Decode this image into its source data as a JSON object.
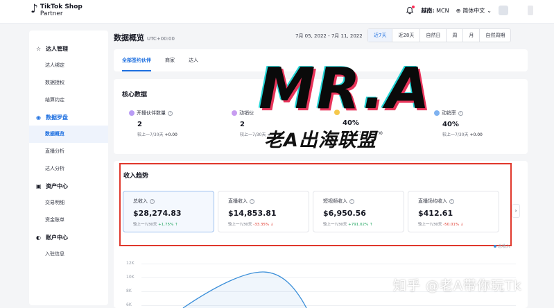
{
  "brand": {
    "name": "TikTok Shop",
    "sub": "Partner"
  },
  "topbar": {
    "region_label": "越南:",
    "region_value": "MCN",
    "language": "简体中文"
  },
  "sidebar": {
    "sections": [
      {
        "label": "达人管理",
        "items": [
          "达人绑定",
          "数据授权",
          "结算约定"
        ]
      },
      {
        "label": "数据罗盘",
        "items": [
          "数据概览",
          "直播分析",
          "达人分析"
        ]
      },
      {
        "label": "资产中心",
        "items": [
          "交易明细",
          "资金账单"
        ]
      },
      {
        "label": "账户中心",
        "items": [
          "入驻信息"
        ]
      }
    ]
  },
  "header": {
    "title": "数据概览",
    "timezone": "UTC+00:00",
    "date_range": "7月 05, 2022 - 7月 11, 2022",
    "periods": [
      "近7天",
      "近28天",
      "自然日",
      "周",
      "月",
      "自然周期"
    ]
  },
  "filter_tabs": [
    "全部签约伙伴",
    "商家",
    "达人"
  ],
  "core": {
    "title": "核心数据",
    "metrics": [
      {
        "label": "开播伙伴数量",
        "value": "2",
        "compare": "较上一7/30天",
        "delta": "+0.00"
      },
      {
        "label": "动销伙",
        "value": "2",
        "compare": "较上一7/30天",
        "delta": "+0.00"
      },
      {
        "label": "",
        "value": "40%",
        "compare": "较上一7/30天",
        "delta": "+0.00"
      },
      {
        "label": "动销率",
        "value": "40%",
        "compare": "较上一7/30天",
        "delta": "+0.00"
      }
    ]
  },
  "trend": {
    "title": "收入趋势",
    "cards": [
      {
        "label": "总收入",
        "value": "$28,274.83",
        "compare": "较上一7/30天",
        "delta": "+1.75%",
        "dir": "↑"
      },
      {
        "label": "直播收入",
        "value": "$14,853.81",
        "compare": "较上一7/30天",
        "delta": "-33.35%",
        "dir": "↓"
      },
      {
        "label": "短视频收入",
        "value": "$6,950.56",
        "compare": "较上一7/30天",
        "delta": "+791.02%",
        "dir": "↑"
      },
      {
        "label": "直播场均收入",
        "value": "$412.61",
        "compare": "较上一7/30天",
        "delta": "-50.01%",
        "dir": "↓"
      }
    ],
    "legend": "总收入",
    "yticks": [
      "12K",
      "10K",
      "8K",
      "6K"
    ]
  },
  "watermark": {
    "big": "MR.A",
    "sub": "老A出海联盟",
    "credit": "知乎 @老A带你玩Tk"
  },
  "colors": {
    "accent": "#1d6fe0",
    "highlight_border": "#e0382c",
    "up": "#1aa35b",
    "down": "#e0382c"
  }
}
